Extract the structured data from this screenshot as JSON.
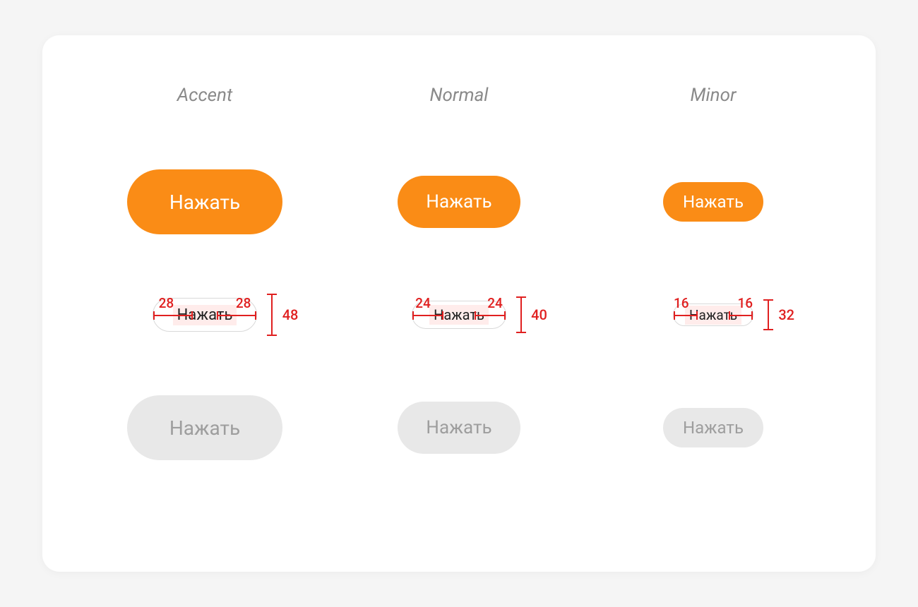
{
  "columns": {
    "accent": {
      "title": "Accent"
    },
    "normal": {
      "title": "Normal"
    },
    "minor": {
      "title": "Minor"
    }
  },
  "button_label": "Нажать",
  "specs": {
    "accent": {
      "pad_left": "28",
      "pad_right": "28",
      "height": "48"
    },
    "normal": {
      "pad_left": "24",
      "pad_right": "24",
      "height": "40"
    },
    "minor": {
      "pad_left": "16",
      "pad_right": "16",
      "height": "32"
    }
  },
  "colors": {
    "accent": "#fa8c16",
    "measure": "#e02020",
    "disabled_bg": "#e8e8e8",
    "disabled_fg": "#9e9e9e",
    "highlight": "#ffeceb"
  }
}
